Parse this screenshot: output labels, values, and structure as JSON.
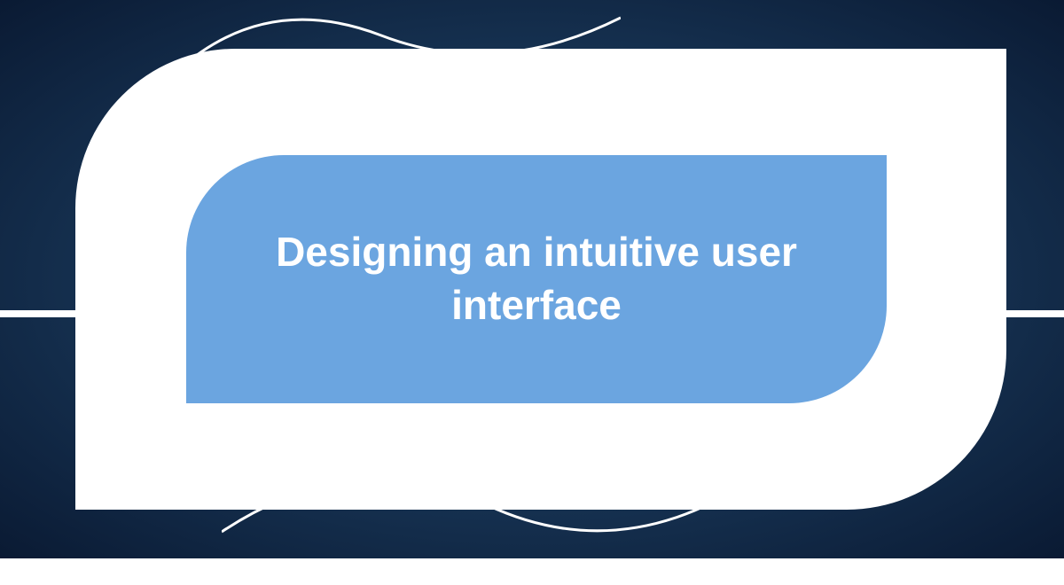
{
  "title": "Designing an intuitive user interface",
  "colors": {
    "inner_shape": "#6ba5e0",
    "outer_shape": "#ffffff",
    "text": "#ffffff"
  }
}
